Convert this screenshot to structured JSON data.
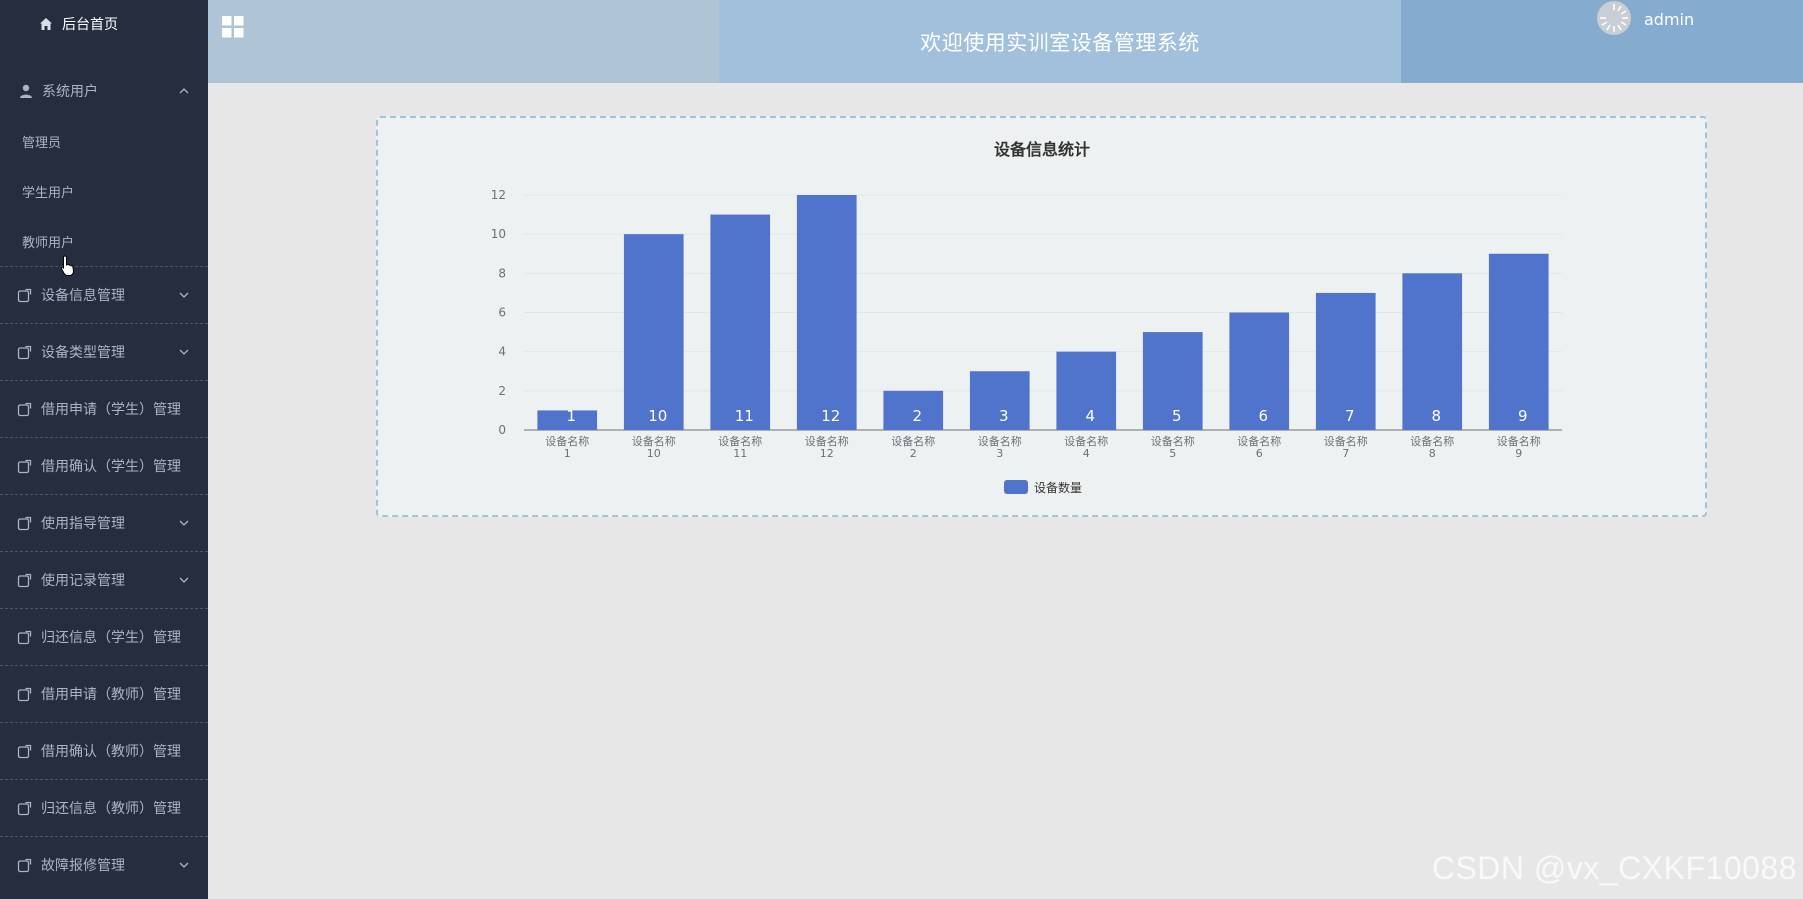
{
  "sidebar": {
    "home": "后台首页",
    "system_users": {
      "label": "系统用户",
      "items": [
        "管理员",
        "学生用户",
        "教师用户"
      ]
    },
    "menu": [
      {
        "label": "设备信息管理",
        "chevron": true
      },
      {
        "label": "设备类型管理",
        "chevron": true
      },
      {
        "label": "借用申请（学生）管理",
        "chevron": false
      },
      {
        "label": "借用确认（学生）管理",
        "chevron": false
      },
      {
        "label": "使用指导管理",
        "chevron": true
      },
      {
        "label": "使用记录管理",
        "chevron": true
      },
      {
        "label": "归还信息（学生）管理",
        "chevron": false
      },
      {
        "label": "借用申请（教师）管理",
        "chevron": false
      },
      {
        "label": "借用确认（教师）管理",
        "chevron": false
      },
      {
        "label": "归还信息（教师）管理",
        "chevron": false
      },
      {
        "label": "故障报修管理",
        "chevron": true
      }
    ]
  },
  "header": {
    "title": "欢迎使用实训室设备管理系统",
    "username": "admin"
  },
  "colors": {
    "sidebar_bg": "#262d3f",
    "bar": "#5073cc",
    "header_left": "#afc5d5",
    "header_mid": "#a1c0db",
    "header_right": "#85acce"
  },
  "chart_data": {
    "type": "bar",
    "title": "设备信息统计",
    "categories": [
      "设备名称\n1",
      "设备名称\n10",
      "设备名称\n11",
      "设备名称\n12",
      "设备名称\n2",
      "设备名称\n3",
      "设备名称\n4",
      "设备名称\n5",
      "设备名称\n6",
      "设备名称\n7",
      "设备名称\n8",
      "设备名称\n9"
    ],
    "series": [
      {
        "name": "设备数量",
        "values": [
          1,
          10,
          11,
          12,
          2,
          3,
          4,
          5,
          6,
          7,
          8,
          9
        ]
      }
    ],
    "ylim": [
      0,
      12
    ],
    "yticks": [
      0,
      2,
      4,
      6,
      8,
      10,
      12
    ],
    "grid": true,
    "legend": "bottom-center"
  },
  "watermark": "CSDN @vx_CXKF10088"
}
